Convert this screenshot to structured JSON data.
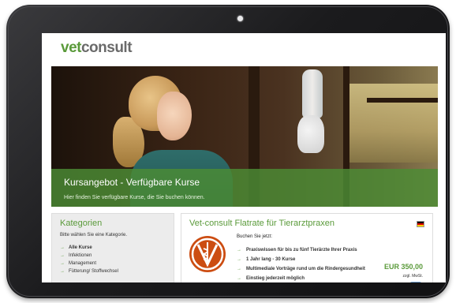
{
  "brand": {
    "logo_vet": "vet",
    "logo_consult": "consult"
  },
  "hero": {
    "title": "Kursangebot - Verfügbare Kurse",
    "subtitle": "Hier finden Sie verfügbare Kurse, die Sie buchen können."
  },
  "sidebar": {
    "title": "Kategorien",
    "hint": "Bitte wählen Sie eine Kategorie.",
    "items": [
      {
        "label": "Alle Kurse",
        "active": true
      },
      {
        "label": "Infektionen"
      },
      {
        "label": "Management"
      },
      {
        "label": "Fütterung/ Stoffwechsel"
      }
    ]
  },
  "main": {
    "title": "Vet-consult Flatrate für Tierarztpraxen",
    "buchen": "Buchen Sie jetzt:",
    "features": [
      "Praxiswissen für bis zu fünf Tierärzte Ihrer Praxis",
      "1 Jahr lang - 30 Kurse",
      "Multimediale Vorträge rund um die Rindergesundheit",
      "Einstieg jederzeit möglich"
    ],
    "price": "EUR 350,00",
    "price_note": "zzgl. MwSt."
  },
  "colors": {
    "brand_green": "#5a9a3a",
    "hero_band": "#4c8c34",
    "logo_orange": "#cc4d12"
  },
  "icons": {
    "arrow": "→",
    "flag": "german-flag-icon",
    "logo": "vet-caduceus-icon"
  }
}
